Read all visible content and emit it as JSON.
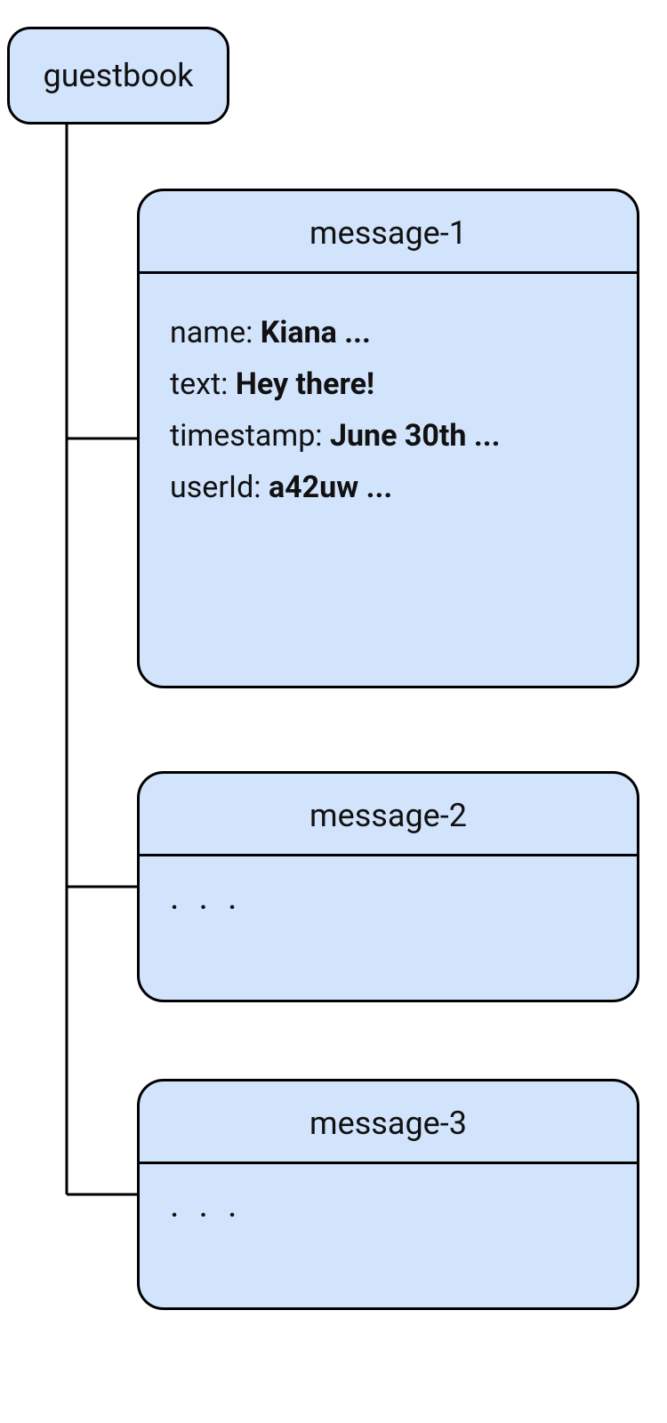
{
  "root": {
    "label": "guestbook"
  },
  "messages": [
    {
      "title": "message-1",
      "fields": [
        {
          "key": "name: ",
          "value": "Kiana ..."
        },
        {
          "key": "text: ",
          "value": "Hey there!"
        },
        {
          "key": "timestamp: ",
          "value": "June 30th ..."
        },
        {
          "key": "userId: ",
          "value": "a42uw ..."
        }
      ]
    },
    {
      "title": "message-2",
      "collapsed": ". . ."
    },
    {
      "title": "message-3",
      "collapsed": ". . ."
    }
  ]
}
